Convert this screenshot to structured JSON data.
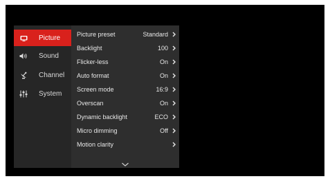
{
  "sidebar": {
    "items": [
      {
        "label": "Picture",
        "icon": "picture-icon",
        "active": true
      },
      {
        "label": "Sound",
        "icon": "speaker-icon",
        "active": false
      },
      {
        "label": "Channel",
        "icon": "satellite-dish-icon",
        "active": false
      },
      {
        "label": "System",
        "icon": "sliders-icon",
        "active": false
      }
    ]
  },
  "menu": {
    "rows": [
      {
        "label": "Picture preset",
        "value": "Standard"
      },
      {
        "label": "Backlight",
        "value": "100"
      },
      {
        "label": "Flicker-less",
        "value": "On"
      },
      {
        "label": "Auto format",
        "value": "On"
      },
      {
        "label": "Screen mode",
        "value": "16:9"
      },
      {
        "label": "Overscan",
        "value": "On"
      },
      {
        "label": "Dynamic backlight",
        "value": "ECO"
      },
      {
        "label": "Micro dimming",
        "value": "Off"
      },
      {
        "label": "Motion clarity",
        "value": ""
      }
    ],
    "more_icon": "chevron-down-icon"
  },
  "colors": {
    "accent": "#d9211c",
    "sidebar_bg": "#262626",
    "menu_bg": "#2e2e2e",
    "screen_bg": "#000000"
  }
}
